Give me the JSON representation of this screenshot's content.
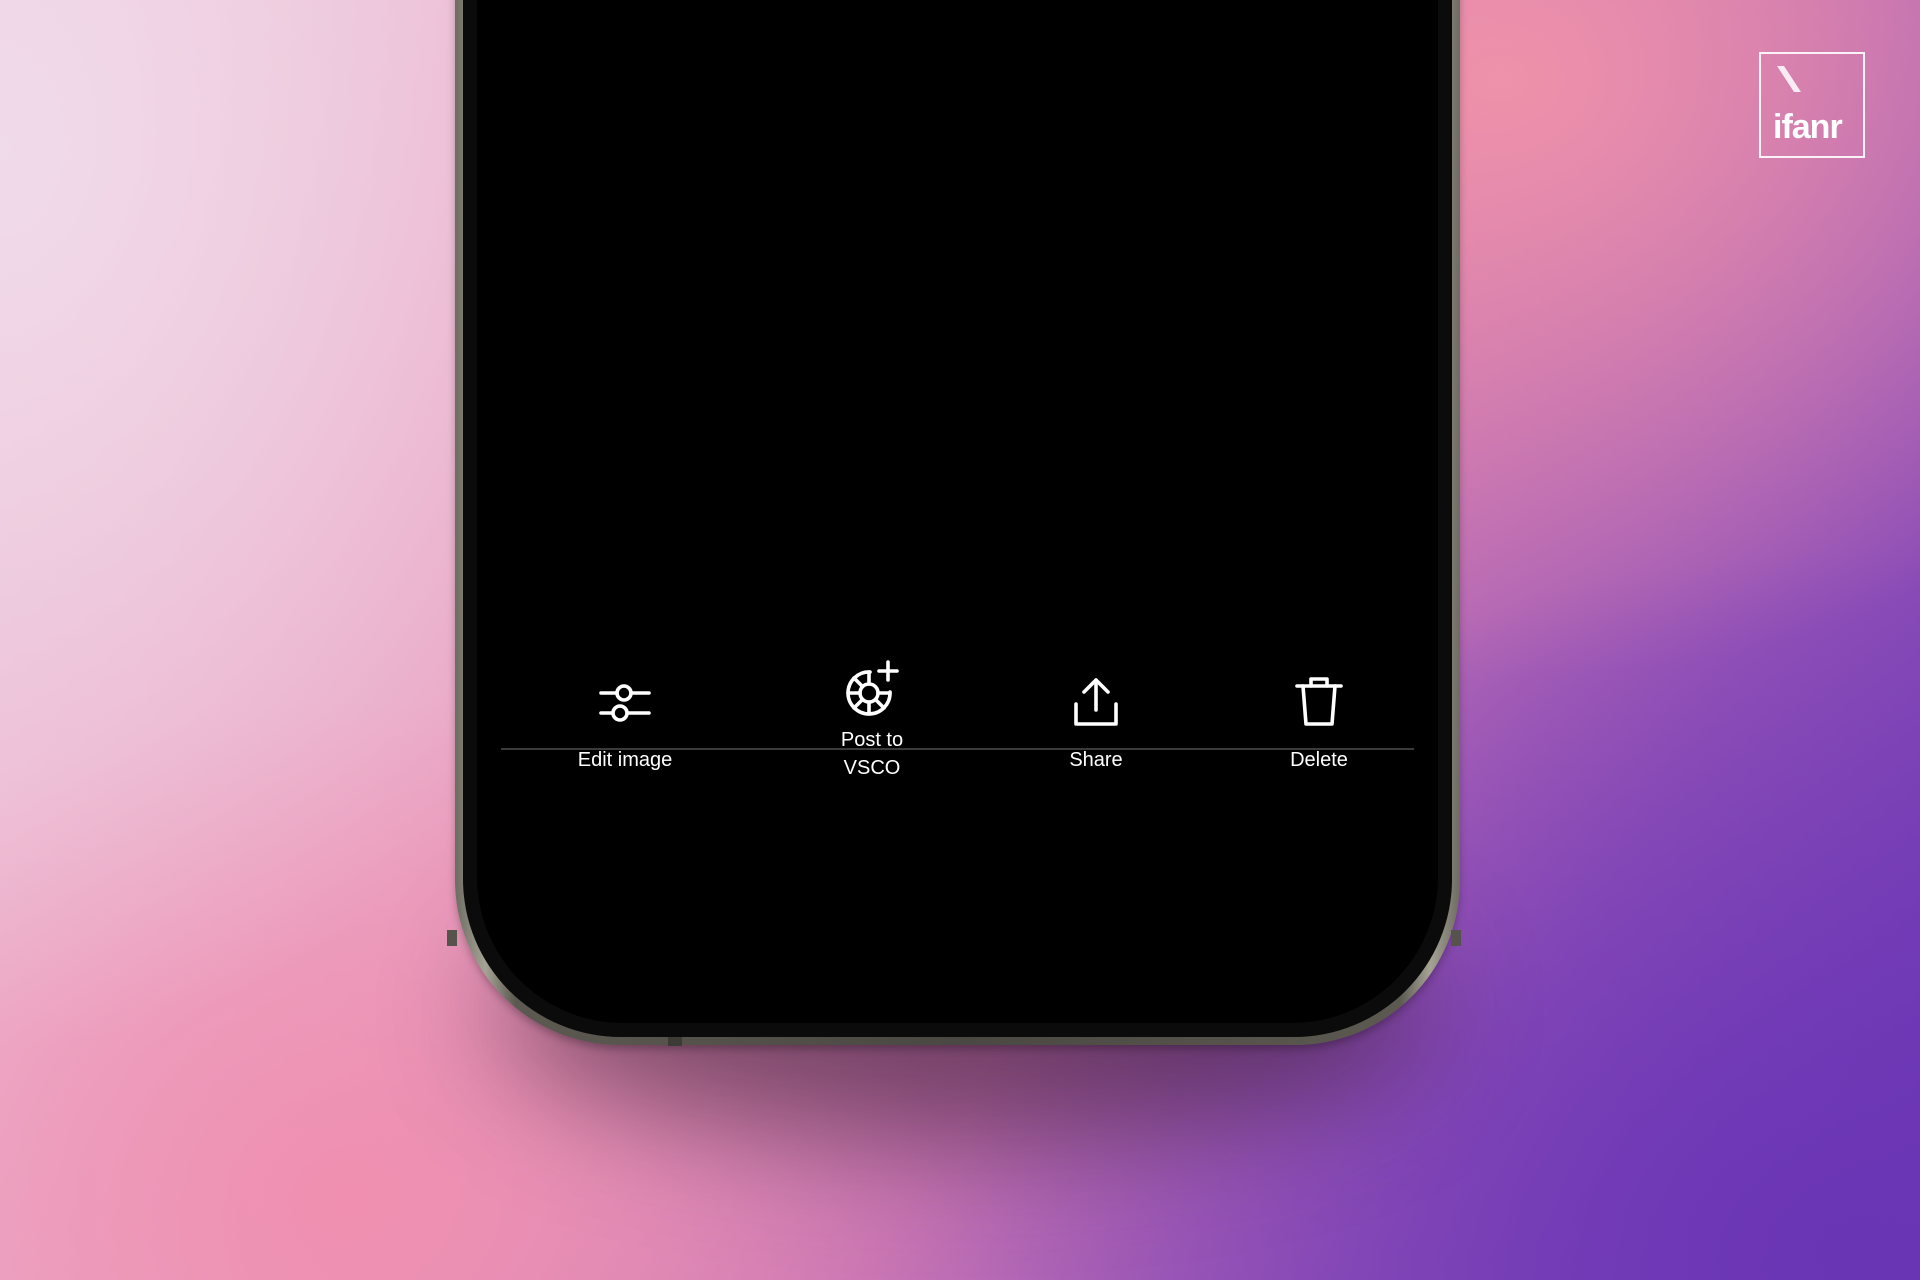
{
  "brand": {
    "logo_text": "ifanr"
  },
  "toolbar": {
    "actions": [
      {
        "id": "edit",
        "label": "Edit image",
        "icon": "sliders-icon"
      },
      {
        "id": "post",
        "label": "Post to\nVSCO",
        "icon": "vsco-post-icon"
      },
      {
        "id": "share",
        "label": "Share",
        "icon": "share-icon"
      },
      {
        "id": "delete",
        "label": "Delete",
        "icon": "trash-icon"
      }
    ]
  },
  "colors": {
    "screen": "#000000",
    "icon": "#ffffff",
    "divider": "#3a3a3a",
    "frame": "#5b5950"
  }
}
